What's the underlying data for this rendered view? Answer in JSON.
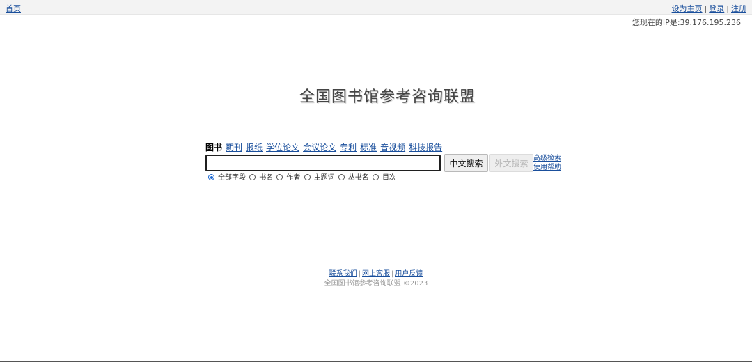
{
  "topbar": {
    "home_label": "首页",
    "set_homepage_label": "设为主页",
    "login_label": "登录",
    "register_label": "注册",
    "separator": "|"
  },
  "ip_text": "您现在的IP是:39.176.195.236",
  "logo_title": "全国图书馆参考咨询联盟",
  "search": {
    "tabs": [
      {
        "label": "图书",
        "active": true
      },
      {
        "label": "期刊",
        "active": false
      },
      {
        "label": "报纸",
        "active": false
      },
      {
        "label": "学位论文",
        "active": false
      },
      {
        "label": "会议论文",
        "active": false
      },
      {
        "label": "专利",
        "active": false
      },
      {
        "label": "标准",
        "active": false
      },
      {
        "label": "音视频",
        "active": false
      },
      {
        "label": "科技报告",
        "active": false
      }
    ],
    "query_value": "",
    "chinese_search_label": "中文搜索",
    "foreign_search_label": "外文搜索",
    "advanced_search_label": "高级检索",
    "help_label": "使用帮助",
    "fields": [
      {
        "label": "全部字段",
        "checked": true
      },
      {
        "label": "书名",
        "checked": false
      },
      {
        "label": "作者",
        "checked": false
      },
      {
        "label": "主题词",
        "checked": false
      },
      {
        "label": "丛书名",
        "checked": false
      },
      {
        "label": "目次",
        "checked": false
      }
    ]
  },
  "footer": {
    "contact_label": "联系我们",
    "online_service_label": "网上客服",
    "feedback_label": "用户反馈",
    "copyright": "全国图书馆参考咨询联盟 ©2023"
  }
}
